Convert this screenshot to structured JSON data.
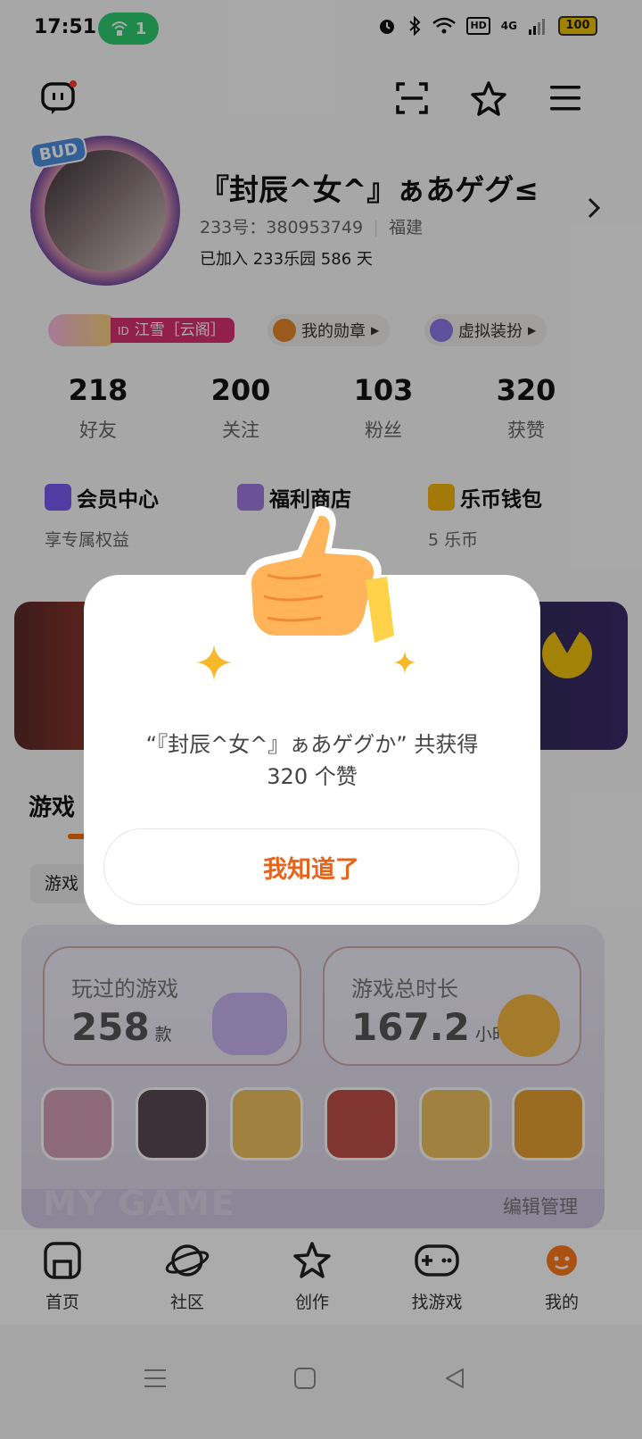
{
  "status_bar": {
    "time": "17:51",
    "hotspot_count": "1",
    "battery": "100",
    "hd_label": "HD",
    "net_label": "4G"
  },
  "profile": {
    "nickname": "『封辰^女^』ぁあゲグ≤",
    "id_label": "233号：380953749",
    "location": "福建",
    "joined": "已加入 233乐园 586 天",
    "avatar_badge": "BUD"
  },
  "tags": {
    "id_tag": "江雪［云阁］",
    "medals": "我的勋章",
    "dress_up": "虚拟装扮"
  },
  "stats": [
    {
      "value": "218",
      "label": "好友"
    },
    {
      "value": "200",
      "label": "关注"
    },
    {
      "value": "103",
      "label": "粉丝"
    },
    {
      "value": "320",
      "label": "获赞"
    }
  ],
  "features": [
    {
      "title": "会员中心",
      "sub": "享专属权益",
      "color": "#7a5cf0"
    },
    {
      "title": "福利商店",
      "sub": "",
      "color": "#a07ae0"
    },
    {
      "title": "乐币钱包",
      "sub": "5 乐币",
      "color": "#f3b510"
    }
  ],
  "section": {
    "title": "游戏",
    "subtab": "游戏"
  },
  "my_games": {
    "played_label": "玩过的游戏",
    "played_value": "258",
    "played_unit": "款",
    "duration_label": "游戏总时长",
    "duration_value": "167.2",
    "duration_unit": "小时",
    "watermark": "MY GAME",
    "edit_label": "编辑管理",
    "icons": [
      "#d6a0b5",
      "#5a4a55",
      "#f0c060",
      "#c0504a",
      "#f0c060",
      "#e6a030"
    ]
  },
  "bottom_nav": [
    {
      "label": "首页"
    },
    {
      "label": "社区"
    },
    {
      "label": "创作"
    },
    {
      "label": "找游戏"
    },
    {
      "label": "我的"
    }
  ],
  "dialog": {
    "line1": "“『封辰^女^』ぁあゲグか” 共获得",
    "line2": "320 个赞",
    "button": "我知道了"
  },
  "colors": {
    "accent": "#e8621a",
    "dim": "rgba(0,0,0,0.33)"
  }
}
